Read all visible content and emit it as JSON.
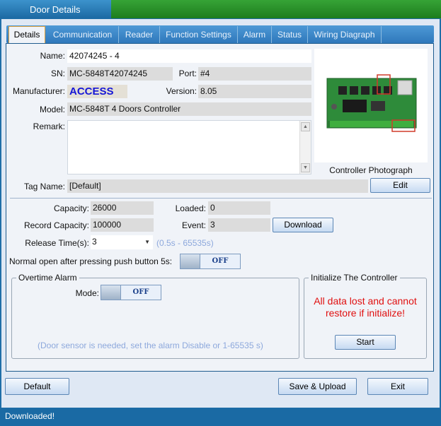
{
  "window": {
    "title": "Door Details"
  },
  "tabs": [
    {
      "label": "Details",
      "active": true
    },
    {
      "label": "Communication"
    },
    {
      "label": "Reader"
    },
    {
      "label": "Function Settings"
    },
    {
      "label": "Alarm"
    },
    {
      "label": "Status"
    },
    {
      "label": "Wiring Diagraph"
    }
  ],
  "details": {
    "name_label": "Name:",
    "name_value": "42074245 - 4",
    "sn_label": "SN:",
    "sn_value": "MC-5848T42074245",
    "port_label": "Port:",
    "port_value": "#4",
    "manufacturer_label": "Manufacturer:",
    "manufacturer_value": "ACCESS",
    "version_label": "Version:",
    "version_value": "8.05",
    "model_label": "Model:",
    "model_value": "MC-5848T 4 Doors Controller",
    "remark_label": "Remark:",
    "remark_value": "",
    "photo_caption": "Controller Photograph",
    "tag_label": "Tag Name:",
    "tag_value": "[Default]",
    "edit_label": "Edit"
  },
  "storage": {
    "capacity_label": "Capacity:",
    "capacity_value": "26000",
    "loaded_label": "Loaded:",
    "loaded_value": "0",
    "record_capacity_label": "Record Capacity:",
    "record_capacity_value": "100000",
    "event_label": "Event:",
    "event_value": "3",
    "download_label": "Download",
    "release_label": "Release Time(s):",
    "release_value": "3",
    "release_hint": "(0.5s - 65535s)",
    "normal_open_label": "Normal open after pressing push button 5s:",
    "normal_open_state": "OFF"
  },
  "overtime": {
    "title": "Overtime Alarm",
    "mode_label": "Mode:",
    "mode_state": "OFF",
    "hint": "(Door sensor is needed, set the alarm Disable or 1-65535 s)"
  },
  "initialize": {
    "title": "Initialize The Controller",
    "warning_line1": "All data lost and cannot",
    "warning_line2": "restore if initialize!",
    "start_label": "Start"
  },
  "footer": {
    "default_label": "Default",
    "save_label": "Save & Upload",
    "exit_label": "Exit"
  },
  "status": {
    "message": "Downloaded!"
  }
}
